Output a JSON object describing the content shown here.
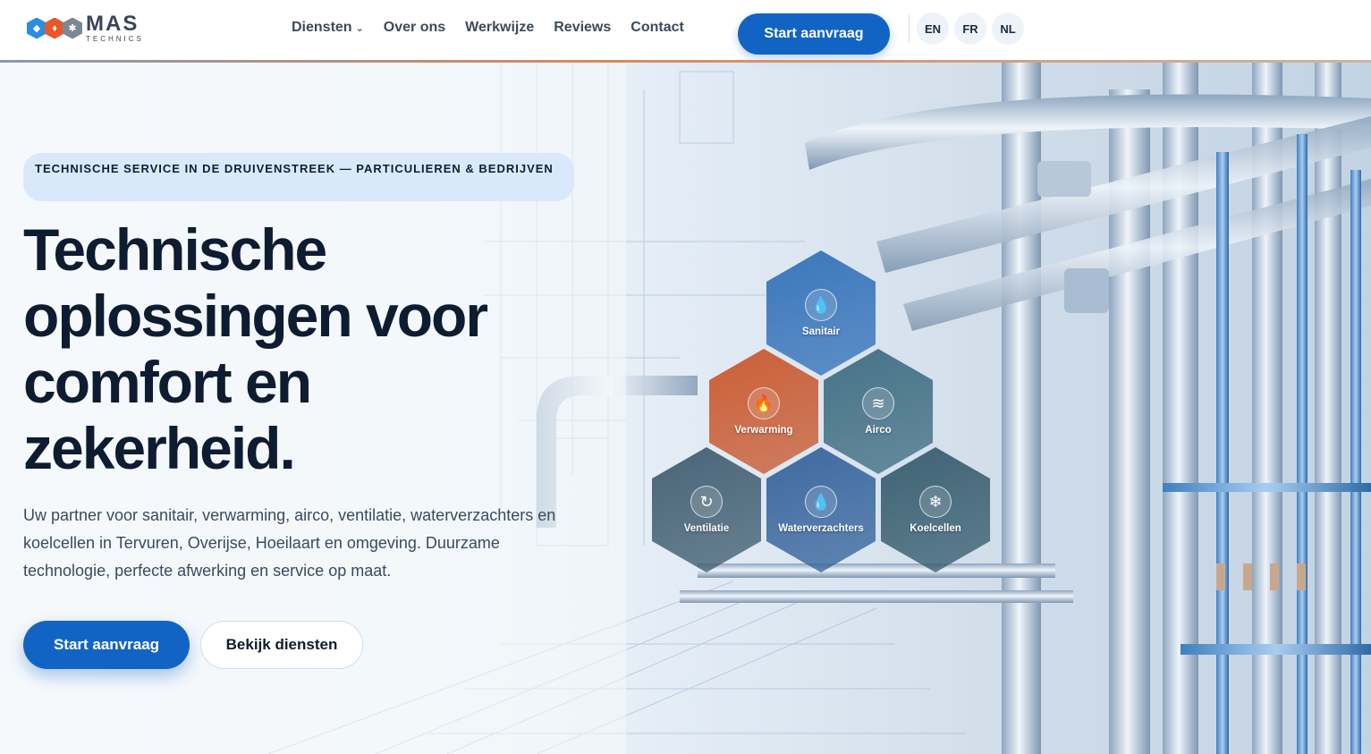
{
  "brand": {
    "name": "MAS",
    "tagline": "TECHNICS"
  },
  "nav": {
    "items": [
      {
        "label": "Diensten"
      },
      {
        "label": "Over ons"
      },
      {
        "label": "Werkwijze"
      },
      {
        "label": "Reviews"
      },
      {
        "label": "Contact"
      }
    ],
    "cta": "Start aanvraag",
    "languages": [
      "EN",
      "FR",
      "NL"
    ]
  },
  "hero": {
    "badge": "TECHNISCHE SERVICE IN DE DRUIVENSTREEK — PARTICULIEREN & BEDRIJVEN",
    "title_lines": [
      "Technische",
      "oplossingen voor",
      "comfort en",
      "zekerheid."
    ],
    "subtitle": "Uw partner voor sanitair, verwarming, airco, ventilatie, waterverzachters en koelcellen in Tervuren, Overijse, Hoeilaart en omgeving. Duurzame technologie, perfecte afwerking en service op maat.",
    "primary_button": "Start aanvraag",
    "secondary_button": "Bekijk diensten"
  },
  "services": [
    {
      "label": "Sanitair",
      "icon": "water-drop-icon",
      "color": "#2f6fb8"
    },
    {
      "label": "Verwarming",
      "icon": "flame-icon",
      "color": "#c9552a"
    },
    {
      "label": "Airco",
      "icon": "wind-icon",
      "color": "#3c6a80"
    },
    {
      "label": "Ventilatie",
      "icon": "refresh-icon",
      "color": "#3d5b6e"
    },
    {
      "label": "Waterverzachters",
      "icon": "water-drops-icon",
      "color": "#33619a"
    },
    {
      "label": "Koelcellen",
      "icon": "snowflake-icon",
      "color": "#345a6c"
    }
  ]
}
